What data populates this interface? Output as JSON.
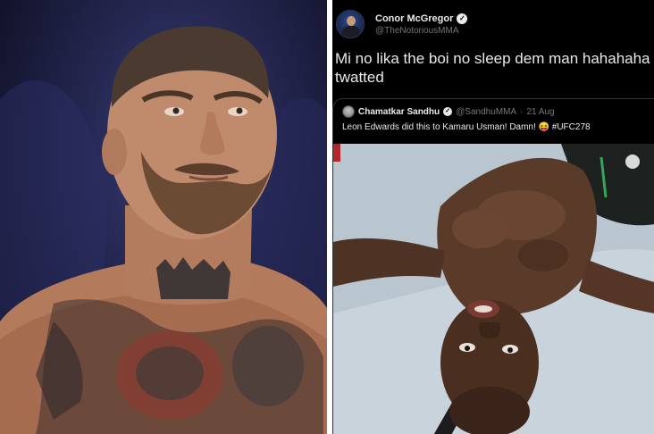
{
  "tweet": {
    "author": {
      "display_name": "Conor McGregor",
      "handle": "@TheNotoriousMMA",
      "verified_icon": "verified-badge-icon"
    },
    "text": "Mi no lika the boi no sleep dem man hahahaha tw",
    "text_line2": "twatted",
    "quoted_tweet": {
      "display_name": "Chamatkar Sandhu",
      "handle": "@SandhuMMA",
      "separator": "·",
      "date": "21 Aug",
      "text": "Leon Edwards did this to Kamaru Usman! Damn! 😝 #UFC278"
    }
  },
  "colors": {
    "background": "#000000",
    "primary_text": "#e7e9ea",
    "secondary_text": "#71767b",
    "border": "#2f3336"
  }
}
